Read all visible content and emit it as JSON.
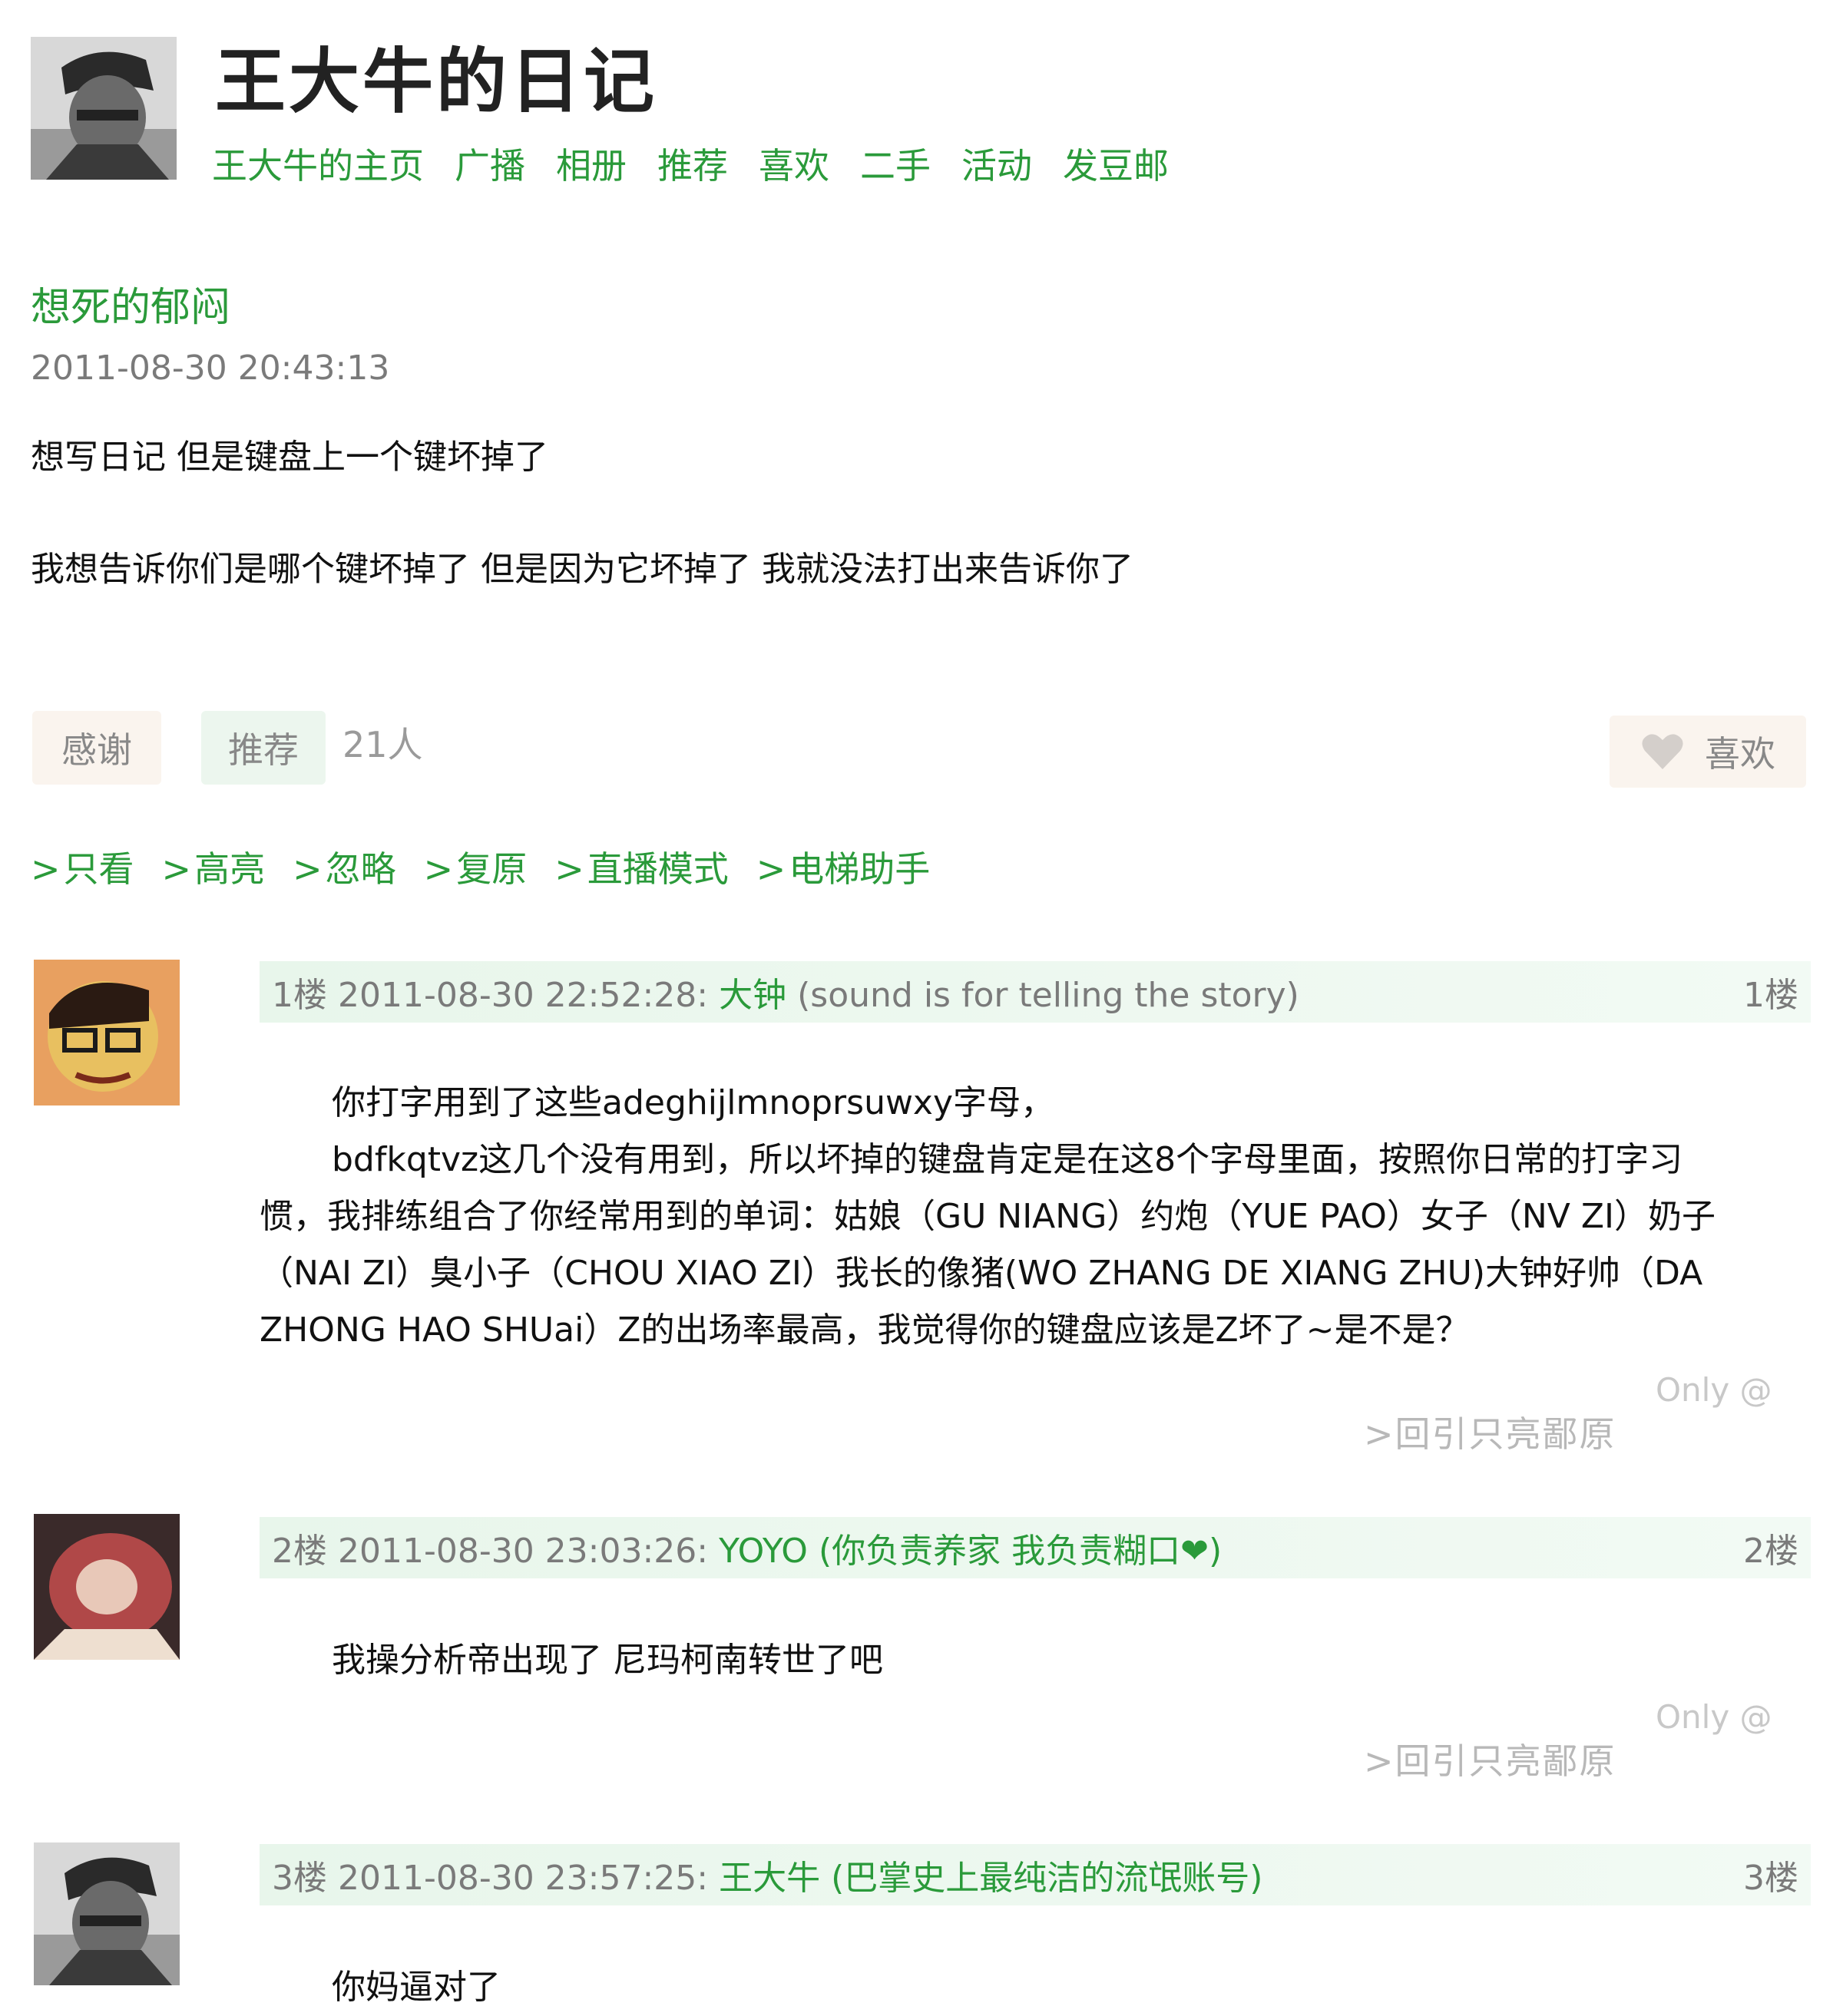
{
  "header": {
    "title": "王大牛的日记",
    "nav": [
      "王大牛的主页",
      "广播",
      "相册",
      "推荐",
      "喜欢",
      "二手",
      "活动",
      "发豆邮"
    ]
  },
  "post": {
    "title": "想死的郁闷",
    "date": "2011-08-30 20:43:13",
    "line1": "想写日记 但是键盘上一个键坏掉了",
    "line2": "我想告诉你们是哪个键坏掉了 但是因为它坏掉了 我就没法打出来告诉你了"
  },
  "actions": {
    "thanks": "感谢",
    "recommend": "推荐",
    "recommend_count": "21人",
    "like": "喜欢"
  },
  "filters": [
    "只看",
    "高亮",
    "忽略",
    "复原",
    "直播模式",
    "电梯助手"
  ],
  "comments": [
    {
      "floor_prefix": "1楼 2011-08-30 22:52:28:",
      "name": "大钟",
      "signature": "(sound is for telling the story)",
      "floor": "1楼",
      "body": [
        "你打字用到了这些adeghijlmnoprsuwxy字母，",
        "bdfkqtvz这几个没有用到，所以坏掉的键盘肯定是在这8个字母里面，按照你日常的打字习",
        "惯，我排练组合了你经常用到的单词：姑娘（GU NIANG）约炮（YUE PAO）女子（NV ZI）奶子",
        "（NAI ZI）臭小子（CHOU XIAO ZI）我长的像猪(WO ZHANG DE XIANG ZHU)大钟好帅（DA",
        "ZHONG HAO SHUai）Z的出场率最高，我觉得你的键盘应该是Z坏了~是不是？"
      ],
      "actions": ">回引只亮鄙原",
      "only": "Only @"
    },
    {
      "floor_prefix": "2楼 2011-08-30 23:03:26:",
      "name": "YOYO",
      "signature": "(你负责养家 我负责糊口❤)",
      "floor": "2楼",
      "body": [
        "我操分析帝出现了 尼玛柯南转世了吧"
      ],
      "actions": ">回引只亮鄙原",
      "only": "Only @"
    },
    {
      "floor_prefix": "3楼 2011-08-30 23:57:25:",
      "name": "王大牛",
      "signature": "(巴掌史上最纯洁的流氓账号)",
      "floor": "3楼",
      "body": [
        "你妈逼对了"
      ]
    }
  ],
  "colors": {
    "link_green": "#2a9a3a",
    "meta_gray": "#7a7a7a",
    "comment_header_bg": "#e8f6eb"
  }
}
